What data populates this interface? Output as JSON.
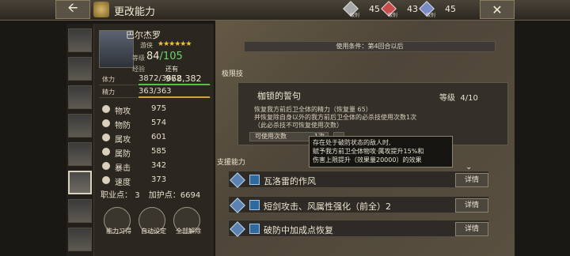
{
  "header": {
    "title": "更改能力",
    "resources": [
      {
        "name": "级别",
        "value": "45",
        "color": "#a8a8a8",
        "icon": "grey-gem-icon"
      },
      {
        "name": "级别",
        "value": "43",
        "color": "#c84c4c",
        "icon": "red-gem-icon"
      },
      {
        "name": "级别",
        "value": "45",
        "color": "#7a8cc8",
        "icon": "blue-gem-icon"
      }
    ],
    "back_icon": "left-arrow-icon",
    "close_icon": "close-icon"
  },
  "hero": {
    "name": "巴尔杰罗",
    "job": "游侠",
    "stars": "★★★★★★",
    "level_label": "等级",
    "level": "84",
    "level_max": "/105",
    "exp_label": "经验",
    "exp_prefix": "还有",
    "exp_value": "968,382",
    "hp_label": "体力",
    "hp": "3872/3872",
    "hp_fill": 1.0,
    "sp_label": "精力",
    "sp": "363/363",
    "sp_fill": 1.0,
    "stats": [
      {
        "label": "物攻",
        "value": "975"
      },
      {
        "label": "物防",
        "value": "574"
      },
      {
        "label": "属攻",
        "value": "601"
      },
      {
        "label": "属防",
        "value": "585"
      },
      {
        "label": "暴击",
        "value": "342"
      },
      {
        "label": "速度",
        "value": "373"
      }
    ],
    "job_points_label": "职业点：",
    "job_points": "3",
    "bonus_label": "加护点：",
    "bonus": "6694",
    "actions": [
      "能力习得",
      "自动设定",
      "全部解除"
    ]
  },
  "main": {
    "use_condition": "使用条件：第4回合以后",
    "limit_section": "极限技",
    "limit_skill": {
      "name": "枷锁的誓句",
      "level_label": "等级",
      "level": "4/10",
      "desc1": "恢复我方前后卫全体的精力（恢复量 65）",
      "desc2": "并恢复除自身以外的我方前后卫全体的必杀技使用次数1次",
      "desc3": "（此必杀技不可恢复使用次数）",
      "uses_label": "可使用次数",
      "uses_value": "1次"
    },
    "tooltip": {
      "line1": "存在处于破防状态的敌人时,",
      "line2": "赋予我方前卫全体物攻·属攻提升15%和",
      "line3": "伤害上限提升（效果量20000）的效果"
    },
    "support_section": "支援能力",
    "support_rows": [
      {
        "name": "瓦洛雷的作风",
        "detail": "详情"
      },
      {
        "name": "短剑攻击、风属性强化（前全）2",
        "detail": "详情"
      },
      {
        "name": "破防中加成点恢复",
        "detail": "详情"
      }
    ]
  }
}
